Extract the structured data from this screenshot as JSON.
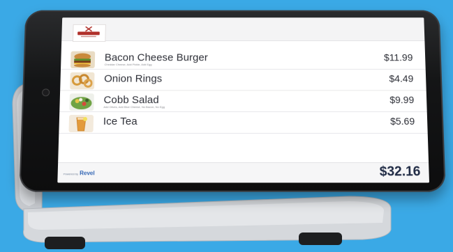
{
  "colors": {
    "background": "#3aa9e6",
    "total_text": "#1f2a44",
    "brand_blue": "#2f63b3"
  },
  "header": {
    "logo_icon": "restaurant-logo-icon"
  },
  "order": {
    "items": [
      {
        "name": "Bacon Cheese Burger",
        "modifiers": "Cheddar Cheese, Add Pickle, Add Egg",
        "price": "$11.99",
        "icon": "burger-thumbnail-icon"
      },
      {
        "name": "Onion Rings",
        "modifiers": "",
        "price": "$4.49",
        "icon": "onion-rings-thumbnail-icon"
      },
      {
        "name": "Cobb Salad",
        "modifiers": "Add Olives, Add Blue Cheese, No Bacon, No Egg",
        "price": "$9.99",
        "icon": "salad-thumbnail-icon"
      },
      {
        "name": "Ice Tea",
        "modifiers": "",
        "price": "$5.69",
        "icon": "iced-tea-thumbnail-icon"
      }
    ],
    "total": "$32.16"
  },
  "footer": {
    "powered_by": "Powered by",
    "brand": "Revel"
  }
}
